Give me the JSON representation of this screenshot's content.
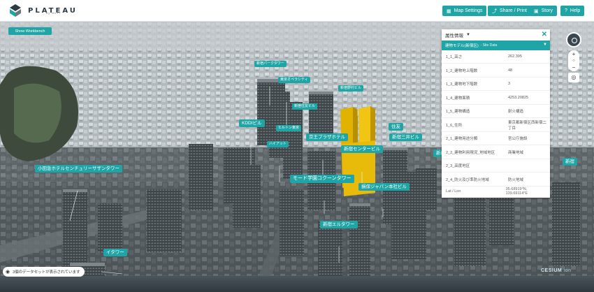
{
  "app": {
    "logo_text": "PLATEAU",
    "logo_sub": "by MLIT"
  },
  "toolbar": {
    "map_settings": "Map Settings",
    "share_print": "Share / Print",
    "story": "Story",
    "help": "Help"
  },
  "workbench_button": "Show Workbench",
  "panel": {
    "title": "属性情報",
    "subtitle": "建物モデル(新宿区)",
    "subtitle_suffix": "- Site Data",
    "rows": [
      {
        "key": "1_1_高さ",
        "value": "262.395"
      },
      {
        "key": "1_2_建物地上階数",
        "value": "48"
      },
      {
        "key": "1_3_建物地下階数",
        "value": "3"
      },
      {
        "key": "1_4_建物面積",
        "value": "4253.20825"
      },
      {
        "key": "1_5_建物構造",
        "value": "耐火構造"
      },
      {
        "key": "1_6_住所",
        "value": "東京都新宿区西新宿二丁目"
      },
      {
        "key": "2_1_建物用途分類",
        "value": "官公庁施設"
      },
      {
        "key": "2_2_建物利用現況_地域地区",
        "value": "商業地域"
      },
      {
        "key": "2_3_高度地区",
        "value": ""
      },
      {
        "key": "2_4_防火及び準防火地域",
        "value": "防火地域"
      }
    ],
    "latlon_label": "Lat / Lon",
    "latlon_value": "35.68919°N, 139.69114°E"
  },
  "labels": {
    "mode": "モード学園コクーンタワー",
    "sompo": "損保ジャパン本社ビル",
    "erutawa": "新宿エルタワー",
    "center": "新宿センタービル",
    "mitsui": "新宿三井ビル",
    "keio": "京王プラザホテル",
    "sumitomo": "新宿住友ビル",
    "nomura": "新宿野村ビル",
    "kddi": "KDDIビル",
    "hilton": "ヒルトン東京",
    "southern": "小田急ホテルセンチュリーサザンタワー",
    "itatower": "イタワー",
    "park": "新宿パークタワー",
    "opera": "東京オペラシティ",
    "shinjuku_i": "新宿アイランドタワー",
    "hyatt": "ハイアット",
    "right1": "新宿",
    "right2": "住友"
  },
  "status": {
    "text": "3個のデータセットが表示されています"
  },
  "credit": {
    "cesium": "CESIUM",
    "ion": "ion"
  }
}
